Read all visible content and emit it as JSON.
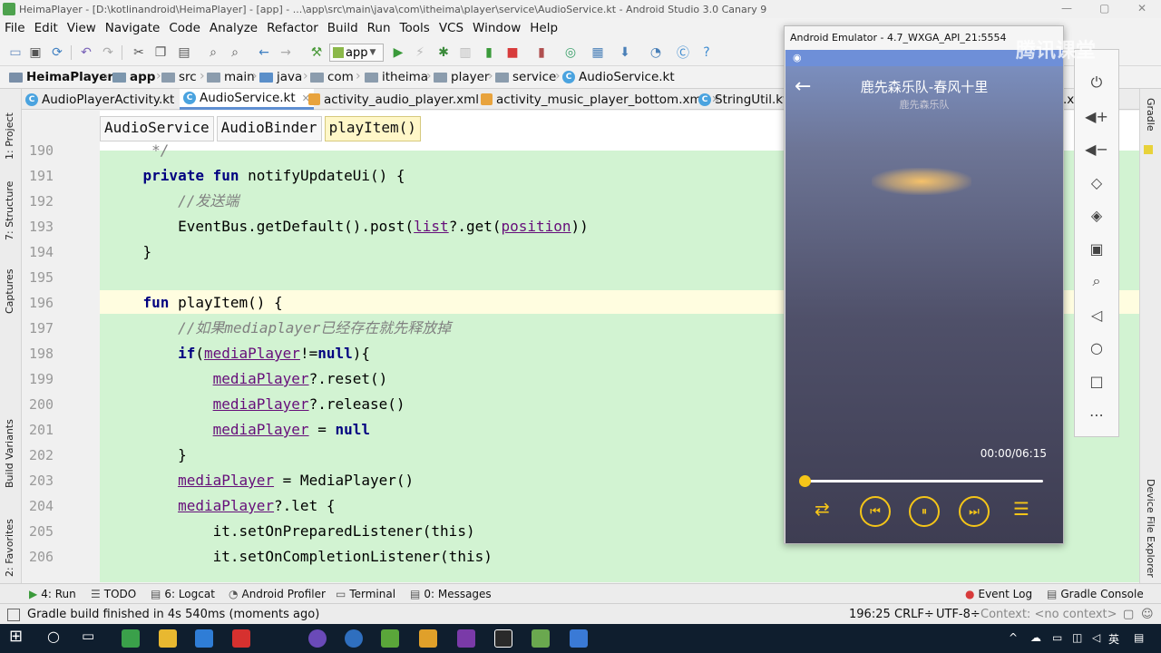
{
  "window": {
    "title": "HeimaPlayer - [D:\\kotlinandroid\\HeimaPlayer] - [app] - ...\\app\\src\\main\\java\\com\\itheima\\player\\service\\AudioService.kt - Android Studio 3.0 Canary 9"
  },
  "menu": [
    "File",
    "Edit",
    "View",
    "Navigate",
    "Code",
    "Analyze",
    "Refactor",
    "Build",
    "Run",
    "Tools",
    "VCS",
    "Window",
    "Help"
  ],
  "toolbar": {
    "run_config": "app"
  },
  "breadcrumb": [
    "HeimaPlayer",
    "app",
    "src",
    "main",
    "java",
    "com",
    "itheima",
    "player",
    "service",
    "AudioService.kt"
  ],
  "tabs": [
    {
      "label": "AudioPlayerActivity.kt",
      "active": false
    },
    {
      "label": "AudioService.kt",
      "active": true
    },
    {
      "label": "activity_audio_player.xml",
      "active": false
    },
    {
      "label": "activity_music_player_bottom.xml",
      "active": false
    },
    {
      "label": "StringUtil.kt",
      "active": false
    },
    {
      "label": ".x",
      "active": false
    }
  ],
  "left_tools": [
    "1: Project",
    "7: Structure",
    "Captures",
    "Build Variants",
    "2: Favorites"
  ],
  "right_tools": [
    "Gradle",
    "Device File Explorer"
  ],
  "code_breadcrumbs": [
    "AudioService",
    "AudioBinder",
    "playItem()"
  ],
  "code_lines": [
    {
      "n": "190",
      "text": "     */"
    },
    {
      "n": "191",
      "text": "    private fun notifyUpdateUi() {"
    },
    {
      "n": "192",
      "text": "        //发送端"
    },
    {
      "n": "193",
      "text": "        EventBus.getDefault().post(list?.get(position))"
    },
    {
      "n": "194",
      "text": "    }"
    },
    {
      "n": "195",
      "text": ""
    },
    {
      "n": "196",
      "text": "    fun playItem() {"
    },
    {
      "n": "197",
      "text": "        //如果mediaplayer已经存在就先释放掉"
    },
    {
      "n": "198",
      "text": "        if(mediaPlayer!=null){"
    },
    {
      "n": "199",
      "text": "            mediaPlayer?.reset()"
    },
    {
      "n": "200",
      "text": "            mediaPlayer?.release()"
    },
    {
      "n": "201",
      "text": "            mediaPlayer = null"
    },
    {
      "n": "202",
      "text": "        }"
    },
    {
      "n": "203",
      "text": "        mediaPlayer = MediaPlayer()"
    },
    {
      "n": "204",
      "text": "        mediaPlayer?.let {"
    },
    {
      "n": "205",
      "text": "            it.setOnPreparedListener(this)"
    },
    {
      "n": "206",
      "text": "            it.setOnCompletionListener(this)"
    }
  ],
  "bottom_tools": [
    {
      "label": "4: Run",
      "icon": "run-icon"
    },
    {
      "label": "TODO",
      "icon": "todo-icon"
    },
    {
      "label": "6: Logcat",
      "icon": "logcat-icon"
    },
    {
      "label": "Android Profiler",
      "icon": "profiler-icon"
    },
    {
      "label": "Terminal",
      "icon": "terminal-icon"
    },
    {
      "label": "0: Messages",
      "icon": "messages-icon"
    },
    {
      "label": "Event Log",
      "icon": "event-log-icon"
    },
    {
      "label": "Gradle Console",
      "icon": "gradle-console-icon"
    }
  ],
  "status": {
    "message": "Gradle build finished in 4s 540ms (moments ago)",
    "position": "196:25",
    "line_sep": "CRLF÷",
    "encoding": "UTF-8÷",
    "context": "Context: <no context>"
  },
  "emulator": {
    "title": "Android Emulator - 4.7_WXGA_API_21:5554",
    "song_title": "鹿先森乐队-春风十里",
    "artist": "鹿先森乐队",
    "time": "00:00/06:15",
    "progress": 0.0,
    "accent": "#f5c518"
  },
  "watermark": "腾讯课堂",
  "taskbar": {
    "ime": "英",
    "tray_caret": "^"
  }
}
